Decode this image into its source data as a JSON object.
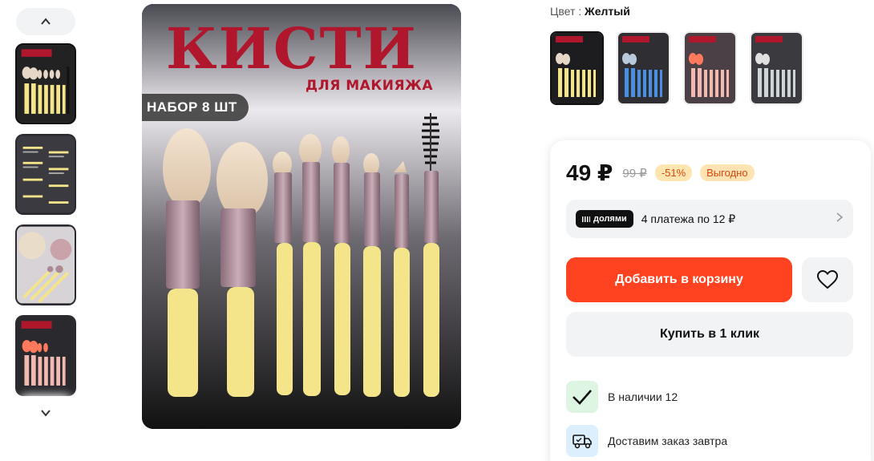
{
  "gallery": {
    "main_title": "КИСТИ",
    "main_subtitle": "ДЛЯ МАКИЯЖА",
    "main_badge": "НАБОР 8 ШТ",
    "thumb_count": 4,
    "active_thumb_index": 0
  },
  "product": {
    "color_label": "Цвет :",
    "color_value": "Желтый",
    "swatch_colors": [
      "yellow",
      "blue",
      "pink",
      "gray"
    ],
    "active_swatch_index": 0
  },
  "card": {
    "price": "49 ₽",
    "old_price": "99 ₽",
    "discount": "-51%",
    "deal_badge": "Выгодно",
    "split": {
      "logo": "долями",
      "text": "4 платежа по 12 ₽"
    },
    "add_to_cart": "Добавить в корзину",
    "buy_one_click": "Купить в 1 клик",
    "stock": "В наличии 12",
    "delivery": "Доставим заказ завтра"
  },
  "colors": {
    "accent": "#ff4320",
    "brand_red": "#b0162c",
    "handle_yellow": "#f4e48a",
    "ferrule_mauve": "#a98a96"
  }
}
